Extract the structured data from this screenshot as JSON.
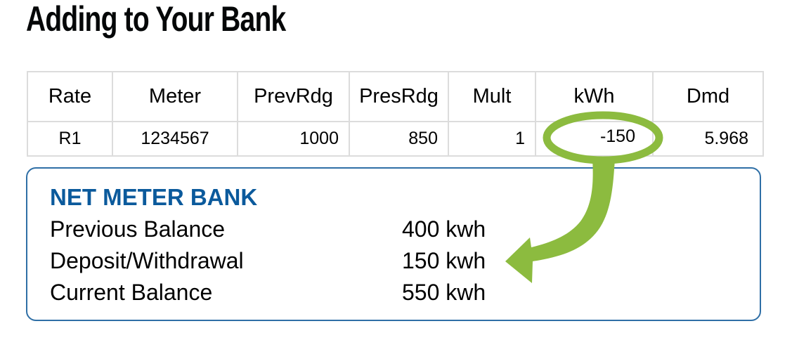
{
  "title": "Adding to Your Bank",
  "bill_table": {
    "headers": [
      "Rate",
      "Meter",
      "PrevRdg",
      "PresRdg",
      "Mult",
      "kWh",
      "Dmd"
    ],
    "rows": [
      [
        "R1",
        "1234567",
        "1000",
        "850",
        "1",
        "-150",
        "5.968"
      ]
    ]
  },
  "net_meter_bank": {
    "title": "NET METER BANK",
    "rows": [
      {
        "label": "Previous Balance",
        "value": "400 kwh"
      },
      {
        "label": "Deposit/Withdrawal",
        "value": "150 kwh"
      },
      {
        "label": "Current Balance",
        "value": "550 kwh"
      }
    ]
  },
  "annotation": {
    "highlight_target": "kWh value -150",
    "arrow_target": "Deposit/Withdrawal value",
    "color": "#8cbb3f"
  },
  "colors": {
    "bank_title": "#0b5a9c",
    "bank_border": "#2f6fa6",
    "table_border": "#dcdcdc"
  }
}
